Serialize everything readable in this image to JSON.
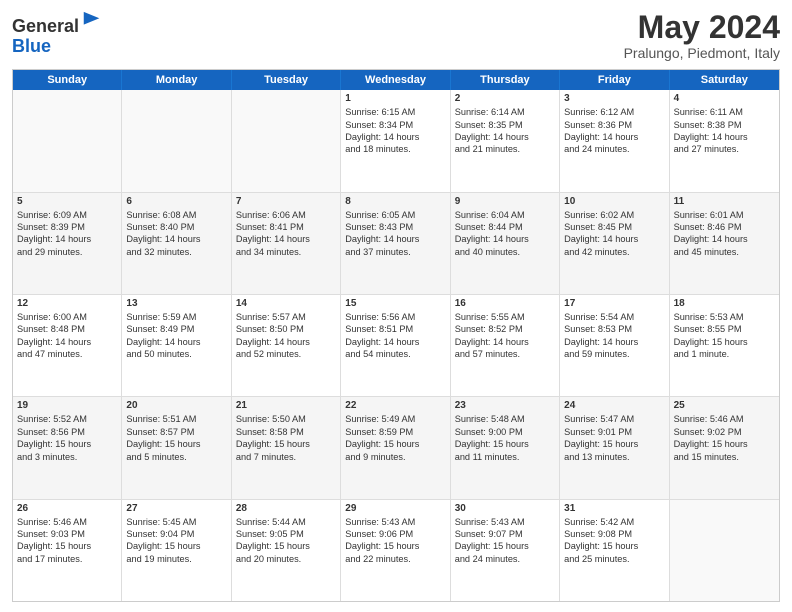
{
  "header": {
    "logo_line1": "General",
    "logo_line2": "Blue",
    "month_title": "May 2024",
    "location": "Pralungo, Piedmont, Italy"
  },
  "days_of_week": [
    "Sunday",
    "Monday",
    "Tuesday",
    "Wednesday",
    "Thursday",
    "Friday",
    "Saturday"
  ],
  "rows": [
    [
      {
        "day": "",
        "lines": [],
        "empty": true
      },
      {
        "day": "",
        "lines": [],
        "empty": true
      },
      {
        "day": "",
        "lines": [],
        "empty": true
      },
      {
        "day": "1",
        "lines": [
          "Sunrise: 6:15 AM",
          "Sunset: 8:34 PM",
          "Daylight: 14 hours",
          "and 18 minutes."
        ]
      },
      {
        "day": "2",
        "lines": [
          "Sunrise: 6:14 AM",
          "Sunset: 8:35 PM",
          "Daylight: 14 hours",
          "and 21 minutes."
        ]
      },
      {
        "day": "3",
        "lines": [
          "Sunrise: 6:12 AM",
          "Sunset: 8:36 PM",
          "Daylight: 14 hours",
          "and 24 minutes."
        ]
      },
      {
        "day": "4",
        "lines": [
          "Sunrise: 6:11 AM",
          "Sunset: 8:38 PM",
          "Daylight: 14 hours",
          "and 27 minutes."
        ]
      }
    ],
    [
      {
        "day": "5",
        "lines": [
          "Sunrise: 6:09 AM",
          "Sunset: 8:39 PM",
          "Daylight: 14 hours",
          "and 29 minutes."
        ]
      },
      {
        "day": "6",
        "lines": [
          "Sunrise: 6:08 AM",
          "Sunset: 8:40 PM",
          "Daylight: 14 hours",
          "and 32 minutes."
        ]
      },
      {
        "day": "7",
        "lines": [
          "Sunrise: 6:06 AM",
          "Sunset: 8:41 PM",
          "Daylight: 14 hours",
          "and 34 minutes."
        ]
      },
      {
        "day": "8",
        "lines": [
          "Sunrise: 6:05 AM",
          "Sunset: 8:43 PM",
          "Daylight: 14 hours",
          "and 37 minutes."
        ]
      },
      {
        "day": "9",
        "lines": [
          "Sunrise: 6:04 AM",
          "Sunset: 8:44 PM",
          "Daylight: 14 hours",
          "and 40 minutes."
        ]
      },
      {
        "day": "10",
        "lines": [
          "Sunrise: 6:02 AM",
          "Sunset: 8:45 PM",
          "Daylight: 14 hours",
          "and 42 minutes."
        ]
      },
      {
        "day": "11",
        "lines": [
          "Sunrise: 6:01 AM",
          "Sunset: 8:46 PM",
          "Daylight: 14 hours",
          "and 45 minutes."
        ]
      }
    ],
    [
      {
        "day": "12",
        "lines": [
          "Sunrise: 6:00 AM",
          "Sunset: 8:48 PM",
          "Daylight: 14 hours",
          "and 47 minutes."
        ]
      },
      {
        "day": "13",
        "lines": [
          "Sunrise: 5:59 AM",
          "Sunset: 8:49 PM",
          "Daylight: 14 hours",
          "and 50 minutes."
        ]
      },
      {
        "day": "14",
        "lines": [
          "Sunrise: 5:57 AM",
          "Sunset: 8:50 PM",
          "Daylight: 14 hours",
          "and 52 minutes."
        ]
      },
      {
        "day": "15",
        "lines": [
          "Sunrise: 5:56 AM",
          "Sunset: 8:51 PM",
          "Daylight: 14 hours",
          "and 54 minutes."
        ]
      },
      {
        "day": "16",
        "lines": [
          "Sunrise: 5:55 AM",
          "Sunset: 8:52 PM",
          "Daylight: 14 hours",
          "and 57 minutes."
        ]
      },
      {
        "day": "17",
        "lines": [
          "Sunrise: 5:54 AM",
          "Sunset: 8:53 PM",
          "Daylight: 14 hours",
          "and 59 minutes."
        ]
      },
      {
        "day": "18",
        "lines": [
          "Sunrise: 5:53 AM",
          "Sunset: 8:55 PM",
          "Daylight: 15 hours",
          "and 1 minute."
        ]
      }
    ],
    [
      {
        "day": "19",
        "lines": [
          "Sunrise: 5:52 AM",
          "Sunset: 8:56 PM",
          "Daylight: 15 hours",
          "and 3 minutes."
        ]
      },
      {
        "day": "20",
        "lines": [
          "Sunrise: 5:51 AM",
          "Sunset: 8:57 PM",
          "Daylight: 15 hours",
          "and 5 minutes."
        ]
      },
      {
        "day": "21",
        "lines": [
          "Sunrise: 5:50 AM",
          "Sunset: 8:58 PM",
          "Daylight: 15 hours",
          "and 7 minutes."
        ]
      },
      {
        "day": "22",
        "lines": [
          "Sunrise: 5:49 AM",
          "Sunset: 8:59 PM",
          "Daylight: 15 hours",
          "and 9 minutes."
        ]
      },
      {
        "day": "23",
        "lines": [
          "Sunrise: 5:48 AM",
          "Sunset: 9:00 PM",
          "Daylight: 15 hours",
          "and 11 minutes."
        ]
      },
      {
        "day": "24",
        "lines": [
          "Sunrise: 5:47 AM",
          "Sunset: 9:01 PM",
          "Daylight: 15 hours",
          "and 13 minutes."
        ]
      },
      {
        "day": "25",
        "lines": [
          "Sunrise: 5:46 AM",
          "Sunset: 9:02 PM",
          "Daylight: 15 hours",
          "and 15 minutes."
        ]
      }
    ],
    [
      {
        "day": "26",
        "lines": [
          "Sunrise: 5:46 AM",
          "Sunset: 9:03 PM",
          "Daylight: 15 hours",
          "and 17 minutes."
        ]
      },
      {
        "day": "27",
        "lines": [
          "Sunrise: 5:45 AM",
          "Sunset: 9:04 PM",
          "Daylight: 15 hours",
          "and 19 minutes."
        ]
      },
      {
        "day": "28",
        "lines": [
          "Sunrise: 5:44 AM",
          "Sunset: 9:05 PM",
          "Daylight: 15 hours",
          "and 20 minutes."
        ]
      },
      {
        "day": "29",
        "lines": [
          "Sunrise: 5:43 AM",
          "Sunset: 9:06 PM",
          "Daylight: 15 hours",
          "and 22 minutes."
        ]
      },
      {
        "day": "30",
        "lines": [
          "Sunrise: 5:43 AM",
          "Sunset: 9:07 PM",
          "Daylight: 15 hours",
          "and 24 minutes."
        ]
      },
      {
        "day": "31",
        "lines": [
          "Sunrise: 5:42 AM",
          "Sunset: 9:08 PM",
          "Daylight: 15 hours",
          "and 25 minutes."
        ]
      },
      {
        "day": "",
        "lines": [],
        "empty": true
      }
    ]
  ]
}
